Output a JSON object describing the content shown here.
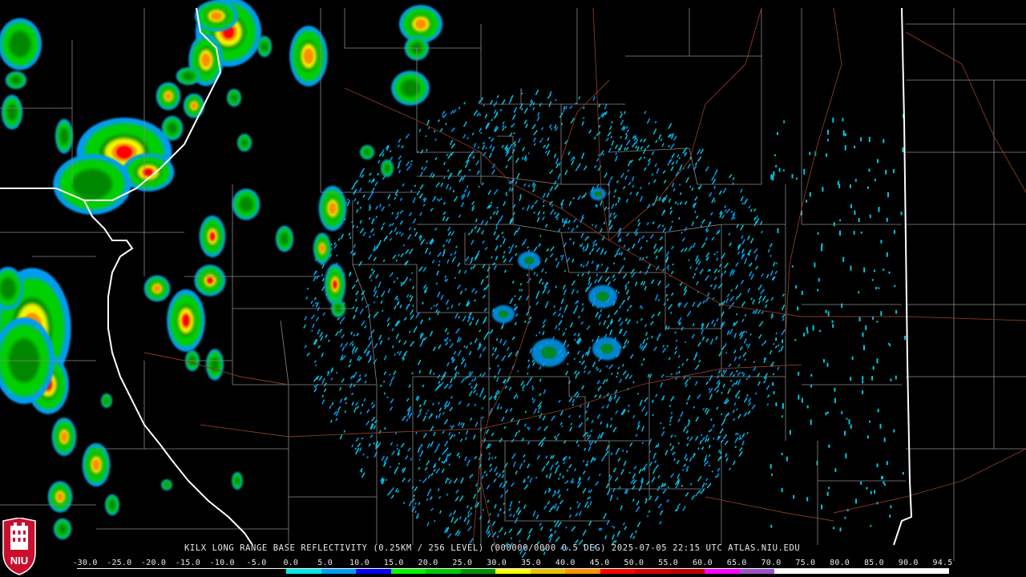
{
  "caption": "KILX LONG RANGE BASE REFLECTIVITY (0.25KM / 256 LEVEL) (000000/0000 0.5 DEG) 2025-07-05 22:15 UTC  ATLAS.NIU.EDU",
  "logo_text": "NIU",
  "scale": {
    "labels": [
      "-30.0",
      "-25.0",
      "-20.0",
      "-15.0",
      "-10.0",
      "-5.0",
      "0.0",
      "5.0",
      "10.0",
      "15.0",
      "20.0",
      "25.0",
      "30.0",
      "35.0",
      "40.0",
      "45.0",
      "50.0",
      "55.0",
      "60.0",
      "65.0",
      "70.0",
      "75.0",
      "80.0",
      "85.0",
      "90.0",
      "94.5"
    ],
    "colors": [
      "#000000",
      "#000000",
      "#000000",
      "#000000",
      "#000000",
      "#000000",
      "#00e8e8",
      "#009cf4",
      "#0000f4",
      "#00f400",
      "#00c800",
      "#009000",
      "#ffff00",
      "#e8c000",
      "#ff9000",
      "#ff0000",
      "#d40000",
      "#bc0000",
      "#ff00ff",
      "#9c54c4",
      "#ffffff",
      "#ffffff",
      "#ffffff",
      "#ffffff",
      "#ffffff"
    ]
  },
  "map": {
    "background": "#000000",
    "county_border_color": "#8a8a8a",
    "state_border_color": "#ffffff",
    "highway_color": "#8a3a22",
    "echo_colors": {
      "light": "#009cf4",
      "cyan": "#00c8e0",
      "green": "#00d000",
      "darkgreen": "#008800",
      "yellow": "#f4f400",
      "orange": "#ff9000",
      "red": "#ff0000"
    }
  }
}
